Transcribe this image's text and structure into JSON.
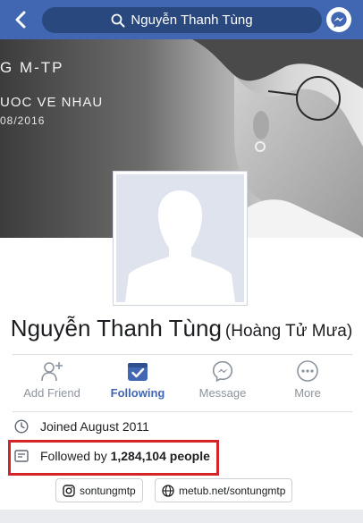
{
  "topbar": {
    "search_text": "Nguyễn Thanh Tùng",
    "icons": [
      "back-chevron-icon",
      "search-icon",
      "messenger-icon"
    ],
    "bar_color": "#4267b2"
  },
  "cover": {
    "line1": "G M-TP",
    "line2": "UOC VE NHAU",
    "line3": "08/2016"
  },
  "profile": {
    "name": "Nguyễn Thanh Tùng",
    "alternate_name": "(Hoàng Tử Mưa)"
  },
  "actions": [
    {
      "label": "Add Friend",
      "icon": "add-friend-icon",
      "active": false
    },
    {
      "label": "Following",
      "icon": "following-icon",
      "active": true
    },
    {
      "label": "Message",
      "icon": "messenger-icon",
      "active": false
    },
    {
      "label": "More",
      "icon": "more-icon",
      "active": false
    }
  ],
  "info": {
    "joined": "Joined August 2011",
    "followed_prefix": "Followed by ",
    "followed_count": "1,284,104 people"
  },
  "links": {
    "instagram": "sontungmtp",
    "website": "metub.net/sontungmtp"
  },
  "colors": {
    "accent": "#4267b2",
    "highlight": "#d4242b",
    "muted": "#8d949e"
  }
}
